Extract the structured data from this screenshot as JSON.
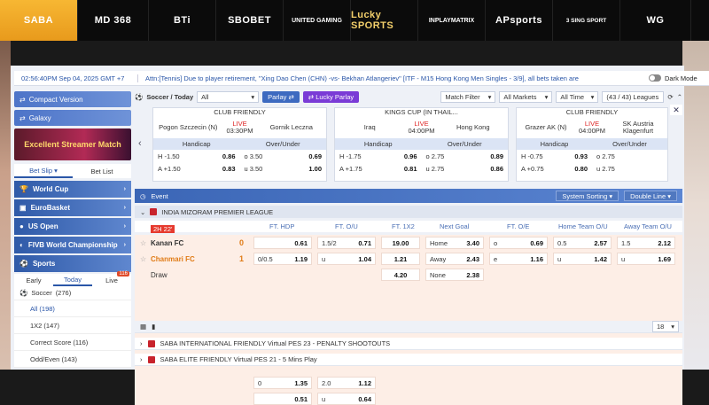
{
  "brands": [
    "SABA",
    "MD 368",
    "BTi",
    "SBOBET",
    "UNITED GAMING",
    "Lucky SPORTS",
    "INPLAYMATRIX",
    "APsports",
    "3 SING SPORT",
    "WG"
  ],
  "ticker": {
    "time": "02:56:40PM Sep 04, 2025 GMT +7",
    "message": "Attn:[Tennis] Due to player retirement, \"Xing Dao Chen (CHN) -vs- Bekhan Atlangeriev\" [ITF - M15 Hong Kong Men Singles - 3/9], all bets taken are",
    "dark_mode": "Dark Mode"
  },
  "sidebar": {
    "compact": "Compact Version",
    "galaxy": "Galaxy",
    "promo": "Excellent Streamer Match",
    "betslip": "Bet Slip",
    "betlist": "Bet List",
    "cats": [
      "World Cup",
      "EuroBasket",
      "US Open",
      "FIVB World Championship",
      "Sports"
    ],
    "tabs": [
      "Early",
      "Today",
      "Live"
    ],
    "live_count": "116",
    "soccer": "Soccer",
    "soccer_count": "(276)",
    "markets": [
      "All (198)",
      "1X2 (147)",
      "Correct Score (116)",
      "Odd/Even (143)"
    ]
  },
  "filters": {
    "title": "Soccer / Today",
    "all": "All",
    "parlay": "Parlay",
    "lucky": "Lucky Parlay",
    "match_filter": "Match Filter",
    "all_markets": "All Markets",
    "all_time": "All Time",
    "leagues": "(43 / 43) Leagues"
  },
  "cards": [
    {
      "league": "CLUB FRIENDLY",
      "home": "Pogon Szczecin (N)",
      "away": "Gornik Leczna",
      "state": "LIVE",
      "time": "03:30PM",
      "h1": "H -1.50",
      "h1v": "0.86",
      "a1": "A +1.50",
      "a1v": "0.83",
      "o": "o 3.50",
      "ov": "0.69",
      "u": "u 3.50",
      "uv": "1.00"
    },
    {
      "league": "KINGS CUP (IN THAIL...",
      "home": "Iraq",
      "away": "Hong Kong",
      "state": "LIVE",
      "time": "04:00PM",
      "h1": "H -1.75",
      "h1v": "0.96",
      "a1": "A +1.75",
      "a1v": "0.81",
      "o": "o 2.75",
      "ov": "0.89",
      "u": "u 2.75",
      "uv": "0.86"
    },
    {
      "league": "CLUB FRIENDLY",
      "home": "Grazer AK (N)",
      "away": "SK Austria Klagenfurt",
      "state": "LIVE",
      "time": "04:00PM",
      "h1": "H -0.75",
      "h1v": "0.93",
      "a1": "A +0.75",
      "a1v": "0.80",
      "o": "o 2.75",
      "ov": "",
      "u": "u 2.75",
      "uv": ""
    }
  ],
  "card_heads": {
    "hdp": "Handicap",
    "ou": "Over/Under"
  },
  "eventbar": {
    "event": "Event",
    "sort": "System Sorting",
    "line": "Double Line"
  },
  "league": "INDIA MIZORAM PREMIER LEAGUE",
  "cols": [
    "FT. HDP",
    "FT. O/U",
    "FT. 1X2",
    "Next Goal",
    "FT. O/E",
    "Home Team O/U",
    "Away Team O/U"
  ],
  "match": {
    "live": "2H 22'",
    "home": "Kanan FC",
    "home_score": "0",
    "away": "Chanmari FC",
    "away_score": "1",
    "draw": "Draw"
  },
  "odds": {
    "hdp1": [
      "",
      "0.61",
      "0/0.5",
      "1.19"
    ],
    "ou1": [
      "1.5/2",
      "0.71",
      "u",
      "1.04"
    ],
    "x12": [
      "19.00",
      "1.21",
      "4.20"
    ],
    "ng": [
      "Home",
      "3.40",
      "Away",
      "2.43",
      "None",
      "2.38"
    ],
    "oe": [
      "o",
      "0.69",
      "e",
      "1.16"
    ],
    "hou": [
      "0.5",
      "2.57",
      "u",
      "1.42"
    ],
    "aou": [
      "1.5",
      "2.12",
      "u",
      "1.69"
    ],
    "hdp2": [
      "0",
      "1.35",
      "",
      "0.51"
    ],
    "ou2": [
      "2.0",
      "1.12",
      "u",
      "0.64"
    ]
  },
  "page_size": "18",
  "more_leagues": [
    "SABA INTERNATIONAL FRIENDLY Virtual PES 23 - PENALTY SHOOTOUTS",
    "SABA ELITE FRIENDLY Virtual PES 21 - 5 Mins Play"
  ]
}
